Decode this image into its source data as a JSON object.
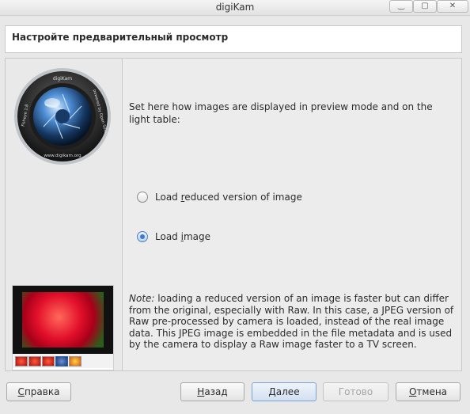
{
  "window": {
    "title": "digiKam",
    "buttons": {
      "minimize": "‿",
      "maximize": "▢",
      "close": "✕"
    }
  },
  "header": {
    "title": "Настройте предварительный просмотр"
  },
  "logo": {
    "ring_text_top": "digiKam",
    "ring_text_right": "powered by Open Source",
    "ring_text_bottom": "www.digikam.org",
    "ring_text_left": "Fisheye 1:8"
  },
  "content": {
    "intro": "Set here how images are displayed in preview mode and on the light table:",
    "options": [
      {
        "label_pre": "Load ",
        "mnemonic": "r",
        "label_post": "educed version of image",
        "checked": false
      },
      {
        "label_pre": "Load ",
        "mnemonic": "i",
        "label_post": "mage",
        "checked": true
      }
    ],
    "note_prefix": "Note:",
    "note_text": " loading a reduced version of an image is faster but can differ from the original, especially with Raw. In this case, a JPEG version of Raw pre-processed by camera is loaded, instead of the real image data. This JPEG image is embedded in the file metadata and is used by the camera to display a Raw image faster to a TV screen."
  },
  "buttons": {
    "help_mnemonic": "С",
    "help_rest": "правка",
    "back_mnemonic": "Н",
    "back_rest": "азад",
    "next_mnemonic": "Д",
    "next_rest": "алее",
    "finish": "Готово",
    "cancel_mnemonic": "О",
    "cancel_rest": "тмена"
  },
  "colors": {
    "accent": "#3d7ad0",
    "primary_button": "#d2e0f1",
    "background": "#e8e8e8"
  }
}
